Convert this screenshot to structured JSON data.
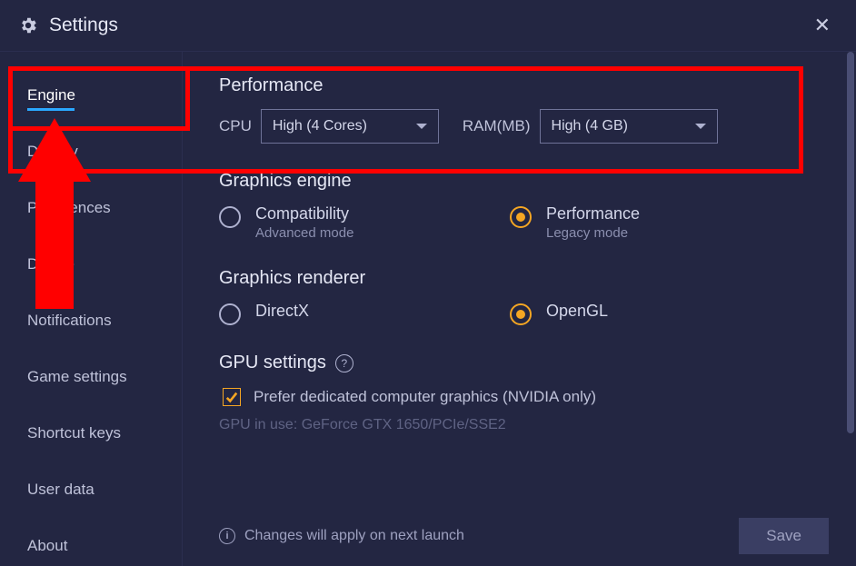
{
  "header": {
    "title": "Settings"
  },
  "sidebar": {
    "items": [
      "Engine",
      "Display",
      "Preferences",
      "Device",
      "Notifications",
      "Game settings",
      "Shortcut keys",
      "User data",
      "About"
    ]
  },
  "performance": {
    "title": "Performance",
    "cpu_label": "CPU",
    "cpu_value": "High (4 Cores)",
    "ram_label": "RAM(MB)",
    "ram_value": "High (4 GB)"
  },
  "graphics_engine": {
    "title": "Graphics engine",
    "options": [
      {
        "label": "Compatibility",
        "sub": "Advanced mode",
        "selected": false
      },
      {
        "label": "Performance",
        "sub": "Legacy mode",
        "selected": true
      }
    ]
  },
  "graphics_renderer": {
    "title": "Graphics renderer",
    "options": [
      {
        "label": "DirectX",
        "selected": false
      },
      {
        "label": "OpenGL",
        "selected": true
      }
    ]
  },
  "gpu": {
    "title": "GPU settings",
    "checkbox_label": "Prefer dedicated computer graphics (NVIDIA only)",
    "checkbox_checked": true,
    "in_use": "GPU in use: GeForce GTX 1650/PCIe/SSE2"
  },
  "footer": {
    "note": "Changes will apply on next launch",
    "save": "Save"
  }
}
